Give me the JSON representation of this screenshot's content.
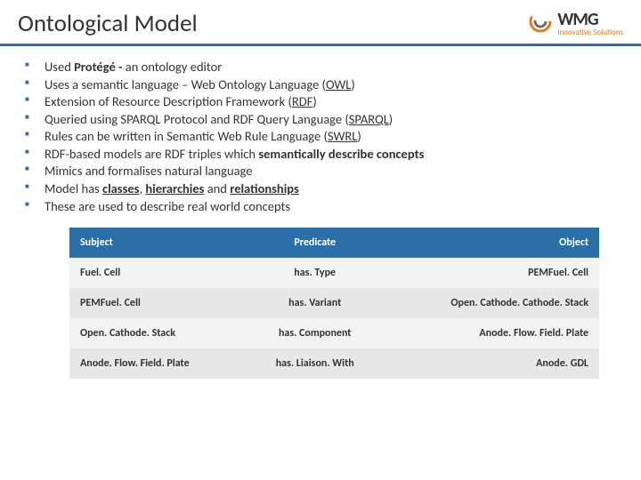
{
  "header": {
    "title": "Ontological Model",
    "logo": {
      "main": "WMG",
      "sub": "Innovative Solutions"
    }
  },
  "bullets": [
    {
      "pre": "Used ",
      "b1": "Protégé - ",
      "post": "an ontology editor"
    },
    {
      "pre": "Uses a semantic language – Web Ontology Language (",
      "u1": "OWL",
      "post": ")"
    },
    {
      "pre": "Extension of Resource Description Framework (",
      "u1": "RDF",
      "post": ")"
    },
    {
      "pre": "Queried using SPARQL Protocol and RDF Query Language (",
      "u1": "SPARQL",
      "post": ")"
    },
    {
      "pre": "Rules can be written in Semantic Web Rule Language (",
      "u1": "SWRL",
      "post": ")"
    },
    {
      "pre": "RDF-based models are RDF triples which ",
      "b1": "semantically describe concepts",
      "post": ""
    },
    {
      "pre": "Mimics and formalises natural language",
      "post": ""
    },
    {
      "pre": "Model has ",
      "bu1": "classes",
      "mid1": ", ",
      "bu2": "hierarchies",
      "mid2": " and ",
      "bu3": "relationships",
      "post": ""
    },
    {
      "pre": "These are used to describe real world concepts",
      "post": ""
    }
  ],
  "table": {
    "headers": [
      "Subject",
      "Predicate",
      "Object"
    ],
    "rows": [
      [
        "Fuel. Cell",
        "has. Type",
        "PEMFuel. Cell"
      ],
      [
        "PEMFuel. Cell",
        "has. Variant",
        "Open. Cathode. Cathode. Stack"
      ],
      [
        "Open. Cathode. Stack",
        "has. Component",
        "Anode. Flow. Field. Plate"
      ],
      [
        "Anode. Flow. Field. Plate",
        "has. Liaison. With",
        "Anode. GDL"
      ]
    ]
  }
}
